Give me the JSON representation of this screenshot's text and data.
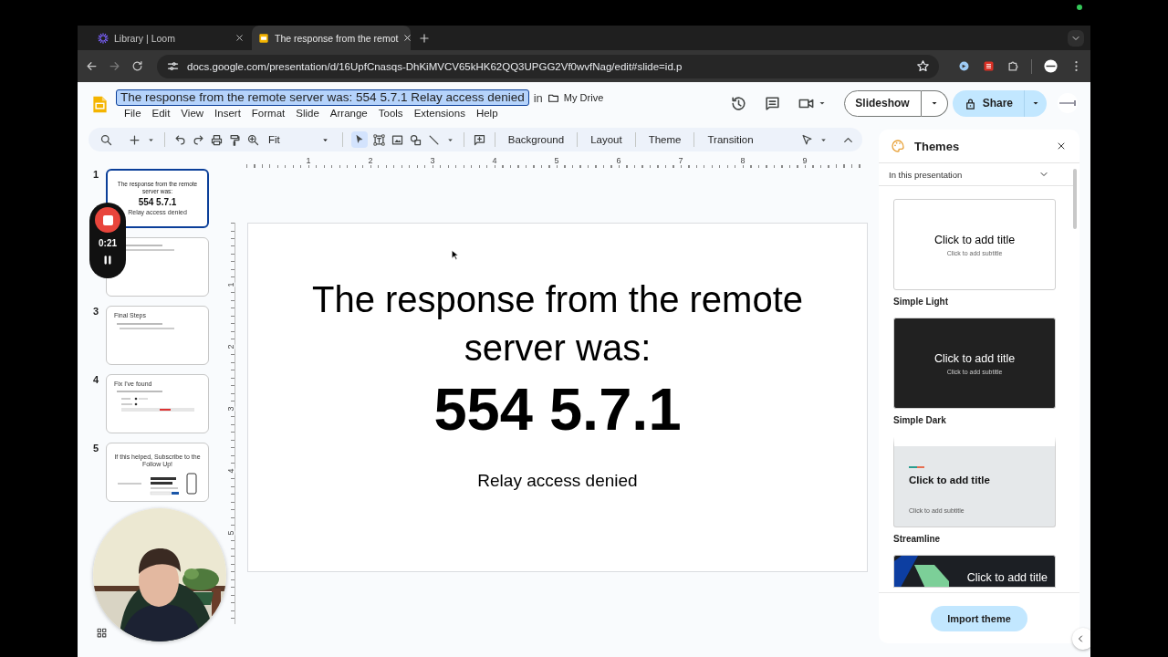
{
  "browser": {
    "tabs": [
      {
        "label": "Library | Loom",
        "selected": false,
        "kind": "starburst"
      },
      {
        "label": "The response from the remot",
        "selected": true,
        "kind": "slides"
      }
    ],
    "address": "docs.google.com/presentation/d/16UpfCnasqs-DhKiMVCV65kHK62QQ3UPGG2Vf0wvfNag/edit#slide=id.p"
  },
  "document": {
    "title": "The response from the remote server was: 554 5.7.1  Relay access denied",
    "title_selected": true,
    "in_label": "in",
    "folder": "My Drive"
  },
  "menu": [
    "File",
    "Edit",
    "View",
    "Insert",
    "Format",
    "Slide",
    "Arrange",
    "Tools",
    "Extensions",
    "Help"
  ],
  "actions": {
    "slideshow": "Slideshow",
    "share": "Share"
  },
  "toolbar": {
    "zoom": "Fit",
    "buttons": [
      "Background",
      "Layout",
      "Theme",
      "Transition"
    ]
  },
  "slides": [
    {
      "number": "1",
      "selected": true,
      "kind": "title",
      "lines": [
        "The response from the remote server was:",
        "554 5.7.1",
        "Relay access denied"
      ]
    },
    {
      "selected": false,
      "kind": "bullets"
    },
    {
      "number": "3",
      "selected": false,
      "kind": "bullets",
      "lines": [
        "Final Steps"
      ]
    },
    {
      "number": "4",
      "selected": false,
      "kind": "table",
      "lines": [
        "Fix I've found"
      ]
    },
    {
      "number": "5",
      "selected": false,
      "kind": "subscribe",
      "lines": [
        "If this helped, Subscribe to the Follow Up!"
      ]
    }
  ],
  "ruler": {
    "horizontal": [
      "1",
      "2",
      "3",
      "4",
      "5",
      "6",
      "7",
      "8",
      "9"
    ],
    "vertical": [
      "1",
      "2",
      "3",
      "4",
      "5"
    ]
  },
  "slide": {
    "title": "The response from the remote server was:",
    "code": "554 5.7.1",
    "subtitle": "Relay access denied"
  },
  "recorder": {
    "time": "0:21"
  },
  "themes": {
    "title": "Themes",
    "section": "In this presentation",
    "items": [
      {
        "kind": "light",
        "name": "Simple Light",
        "title": "Click to add title",
        "subtitle": "Click to add subtitle"
      },
      {
        "kind": "dark",
        "name": "Simple Dark",
        "title": "Click to add title",
        "subtitle": "Click to add subtitle"
      },
      {
        "kind": "streamline",
        "name": "Streamline",
        "title": "Click to add title",
        "subtitle": "Click to add subtitle"
      },
      {
        "kind": "geometric",
        "title": "Click to add title"
      }
    ],
    "import": "Import theme"
  }
}
